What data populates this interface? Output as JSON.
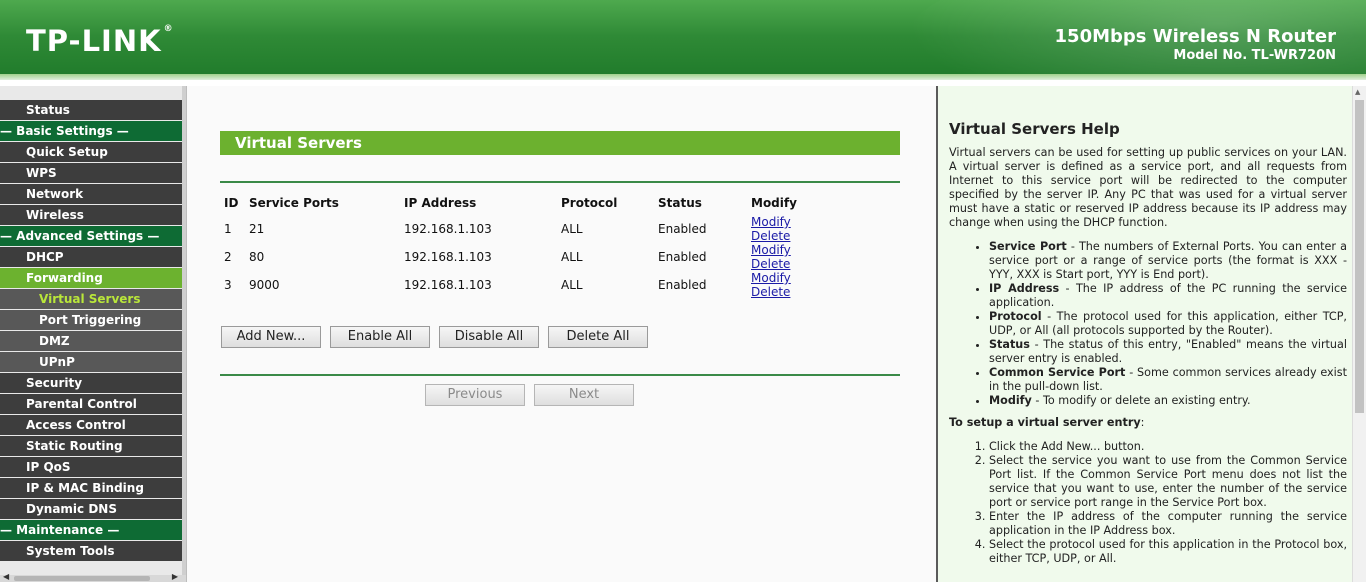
{
  "header": {
    "logo": "TP-LINK",
    "logo_mark": "®",
    "product": "150Mbps Wireless N Router",
    "model": "Model No. TL-WR720N"
  },
  "sidebar": {
    "items": [
      {
        "label": "Status",
        "type": "item"
      },
      {
        "label": "— Basic Settings —",
        "type": "section"
      },
      {
        "label": "Quick Setup",
        "type": "item"
      },
      {
        "label": "WPS",
        "type": "item"
      },
      {
        "label": "Network",
        "type": "item"
      },
      {
        "label": "Wireless",
        "type": "item"
      },
      {
        "label": "— Advanced Settings —",
        "type": "section"
      },
      {
        "label": "DHCP",
        "type": "item"
      },
      {
        "label": "Forwarding",
        "type": "active"
      },
      {
        "label": "Virtual Servers",
        "type": "sub-current"
      },
      {
        "label": "Port Triggering",
        "type": "sub"
      },
      {
        "label": "DMZ",
        "type": "sub"
      },
      {
        "label": "UPnP",
        "type": "sub"
      },
      {
        "label": "Security",
        "type": "item"
      },
      {
        "label": "Parental Control",
        "type": "item"
      },
      {
        "label": "Access Control",
        "type": "item"
      },
      {
        "label": "Static Routing",
        "type": "item"
      },
      {
        "label": "IP QoS",
        "type": "item"
      },
      {
        "label": "IP & MAC Binding",
        "type": "item"
      },
      {
        "label": "Dynamic DNS",
        "type": "item"
      },
      {
        "label": "— Maintenance —",
        "type": "section"
      },
      {
        "label": "System Tools",
        "type": "item"
      }
    ]
  },
  "main": {
    "title": "Virtual Servers",
    "table": {
      "headers": [
        "ID",
        "Service Ports",
        "IP Address",
        "Protocol",
        "Status",
        "Modify"
      ],
      "rows": [
        {
          "id": "1",
          "port": "21",
          "ip": "192.168.1.103",
          "protocol": "ALL",
          "status": "Enabled"
        },
        {
          "id": "2",
          "port": "80",
          "ip": "192.168.1.103",
          "protocol": "ALL",
          "status": "Enabled"
        },
        {
          "id": "3",
          "port": "9000",
          "ip": "192.168.1.103",
          "protocol": "ALL",
          "status": "Enabled"
        }
      ],
      "modify_label": "Modify",
      "delete_label": "Delete"
    },
    "buttons": {
      "add_new": "Add New...",
      "enable_all": "Enable All",
      "disable_all": "Disable All",
      "delete_all": "Delete All",
      "previous": "Previous",
      "next": "Next"
    }
  },
  "help": {
    "title": "Virtual Servers Help",
    "intro": "Virtual servers can be used for setting up public services on your LAN. A virtual server is defined as a service port, and all requests from Internet to this service port will be redirected to the computer specified by the server IP. Any PC that was used for a virtual server must have a static or reserved IP address because its IP address may change when using the DHCP function.",
    "bullets": [
      {
        "term": "Service Port",
        "text": " - The numbers of External Ports. You can enter a service port or a range of service ports (the format is XXX - YYY, XXX is Start port, YYY is End port)."
      },
      {
        "term": "IP Address",
        "text": " - The IP address of the PC running the service application."
      },
      {
        "term": "Protocol",
        "text": " - The protocol used for this application, either TCP, UDP, or All (all protocols supported by the Router)."
      },
      {
        "term": "Status",
        "text": " - The status of this entry, \"Enabled\" means the virtual server entry is enabled."
      },
      {
        "term": "Common Service Port",
        "text": " - Some common services already exist in the pull-down list."
      },
      {
        "term": "Modify",
        "text": " - To modify or delete an existing entry."
      }
    ],
    "setup_heading": "To setup a virtual server entry",
    "setup_colon": ":",
    "steps": [
      "Click the Add New... button.",
      "Select the service you want to use from the Common Service Port list. If the Common Service Port menu does not list the service that you want to use, enter the number of the service port or service port range in the Service Port box.",
      "Enter the IP address of the computer running the service application in the IP Address box.",
      "Select the protocol used for this application in the Protocol box, either TCP, UDP, or All."
    ]
  }
}
